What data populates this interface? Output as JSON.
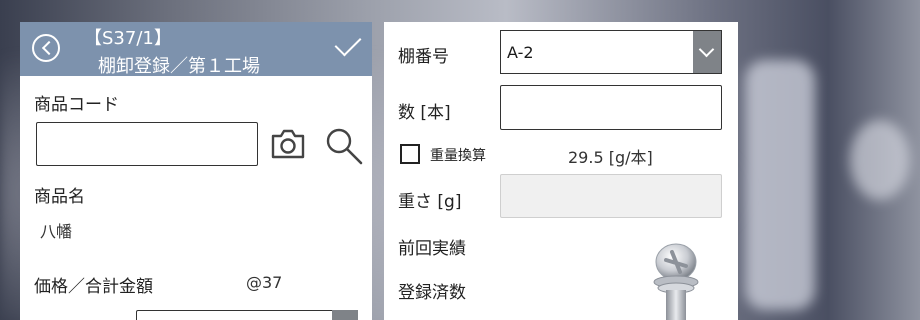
{
  "header": {
    "code": "【S37/1】",
    "title": "棚卸登録／第１工場",
    "back_icon": "back-circle-icon",
    "confirm_icon": "checkmark-icon"
  },
  "left": {
    "product_code_label": "商品コード",
    "product_code_value": "",
    "camera_icon": "camera-icon",
    "search_icon": "search-icon",
    "product_name_label": "商品名",
    "product_name_value": "八幡",
    "price_label": "価格／合計金額",
    "price_value": "@37"
  },
  "right": {
    "shelf_label": "棚番号",
    "shelf_value": "A-2",
    "qty_label": "数 [本]",
    "qty_value": "",
    "weight_convert_label": "重量換算",
    "weight_convert_checked": false,
    "unit_weight": "29.5 [g/本]",
    "weight_label": "重さ [g]",
    "weight_value": "",
    "prev_result_label": "前回実績",
    "registered_label": "登録済数"
  }
}
